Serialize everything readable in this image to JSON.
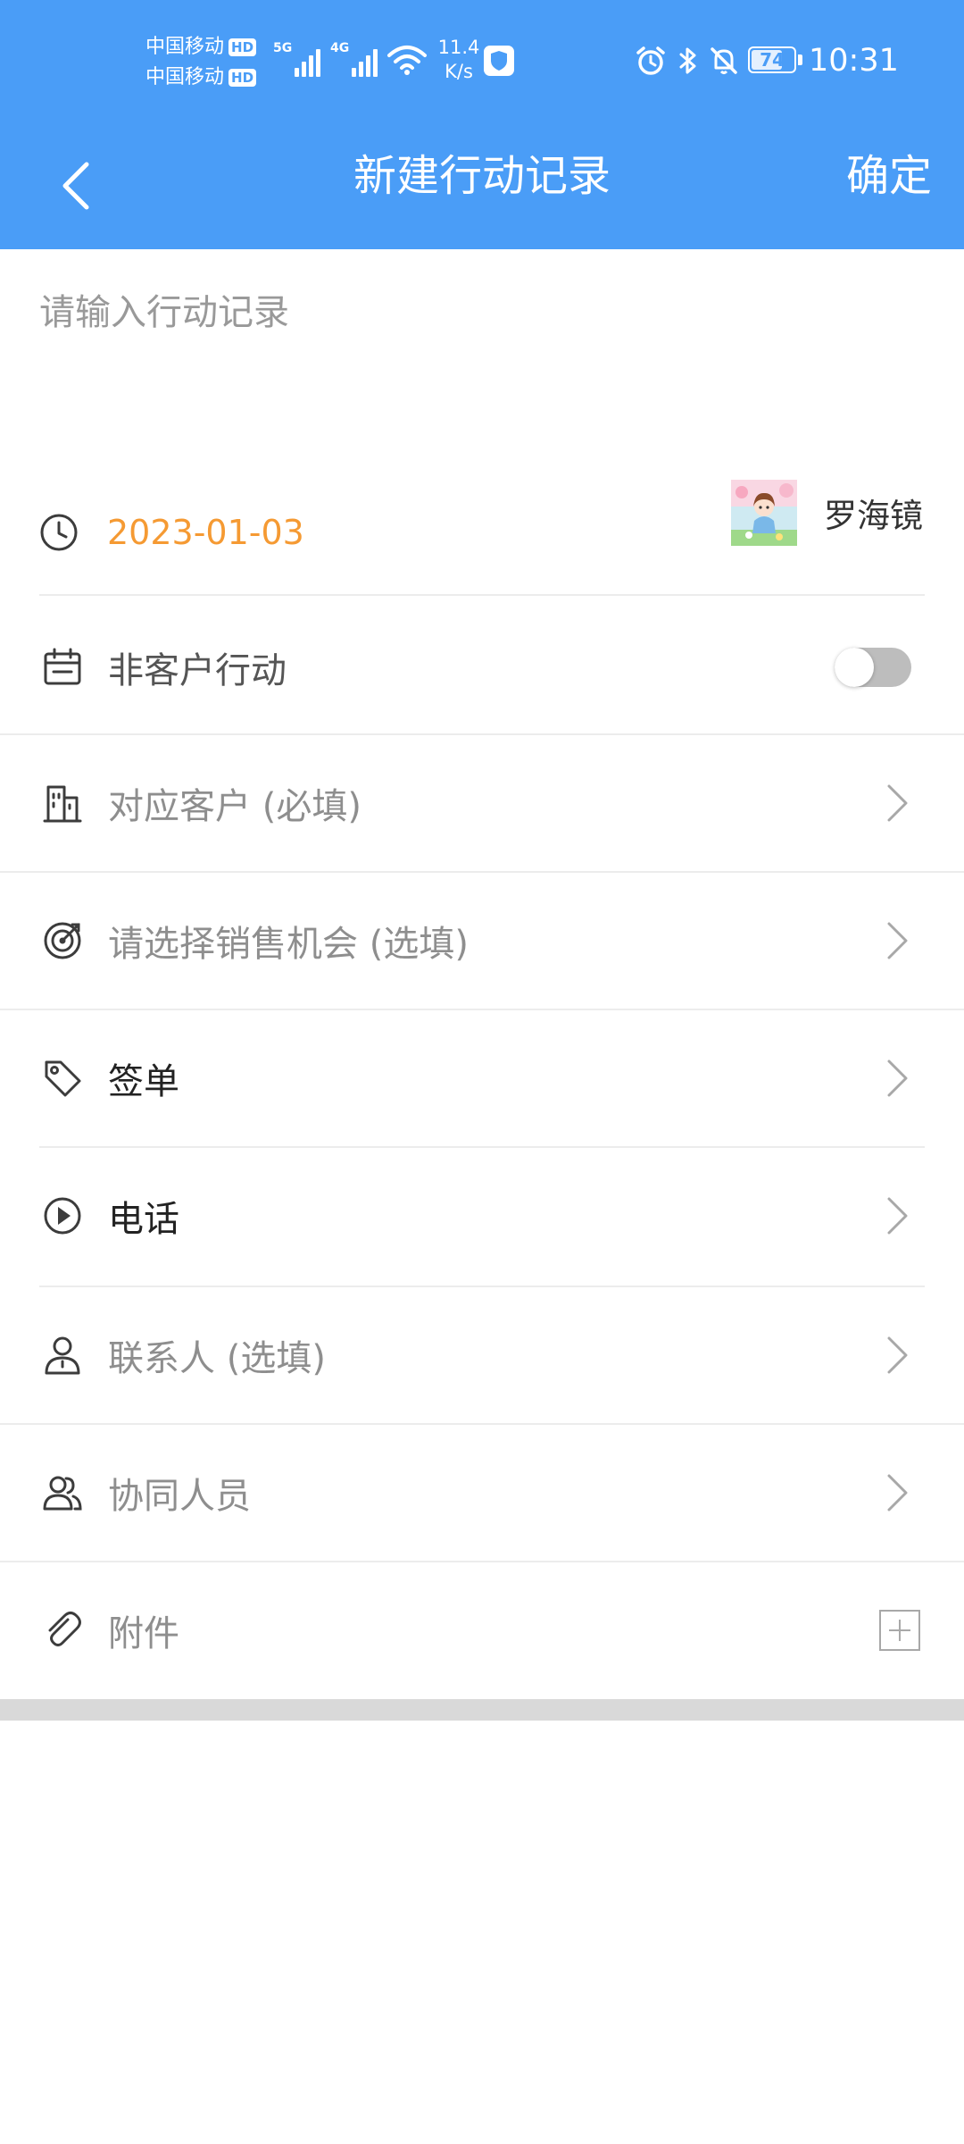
{
  "status_bar": {
    "carrier_1": "中国移动",
    "carrier_2": "中国移动",
    "hd_label": "HD",
    "signal_1_gen": "5G",
    "signal_2_gen": "4G",
    "net_speed_value": "11.4",
    "net_speed_unit": "K/s",
    "battery_level": "74",
    "battery_fraction": 0.74,
    "time": "10:31",
    "icons": [
      "wifi-icon",
      "shield-icon",
      "alarm-icon",
      "bluetooth-icon",
      "bell-off-icon",
      "battery-icon"
    ]
  },
  "nav": {
    "title": "新建行动记录",
    "confirm_label": "确定",
    "back_icon": "chevron-left-icon"
  },
  "form": {
    "record_input": {
      "placeholder": "请输入行动记录",
      "value": ""
    },
    "date": "2023-01-03",
    "owner_name": "罗海镜",
    "rows": [
      {
        "icon": "calendar-icon",
        "label": "非客户行动",
        "control": "toggle",
        "toggle_on": false
      },
      {
        "icon": "building-icon",
        "label": "对应客户 (必填)",
        "control": "chevron"
      },
      {
        "icon": "target-icon",
        "label": "请选择销售机会 (选填)",
        "control": "chevron"
      },
      {
        "icon": "tag-icon",
        "label": "签单",
        "control": "chevron"
      },
      {
        "icon": "play-circle-icon",
        "label": "电话",
        "control": "chevron"
      },
      {
        "icon": "person-icon",
        "label": "联系人 (选填)",
        "control": "chevron"
      },
      {
        "icon": "people-icon",
        "label": "协同人员",
        "control": "chevron"
      },
      {
        "icon": "paperclip-icon",
        "label": "附件",
        "control": "plus"
      }
    ]
  },
  "colors": {
    "header_bg": "#4a9df7",
    "date_accent": "#f59a33",
    "toggle_off": "#bdbdbd",
    "divider": "#ececec"
  }
}
